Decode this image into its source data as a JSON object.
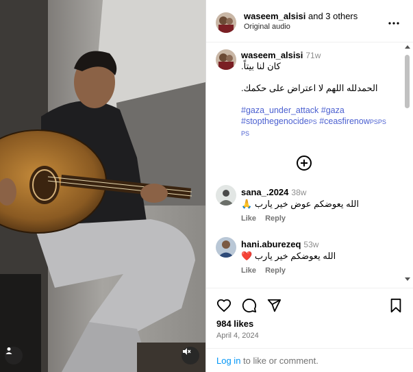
{
  "header": {
    "username": "waseem_alsisi",
    "others": "and 3 others",
    "subtitle": "Original audio",
    "more_icon": "more-horizontal-icon"
  },
  "caption": {
    "username": "waseem_alsisi",
    "time": "71w",
    "line1": "كان لنا بيتاً.",
    "line2": "الحمدلله اللهم لا اعتراض على حكمك.",
    "hashtags": [
      "#gaza_under_attack",
      "#gaza",
      "#stopthegenocide",
      "#ceasfirenow"
    ],
    "tag_suffix_1": "PS",
    "tag_suffix_2": "PSPS",
    "tag_suffix_3": "PS"
  },
  "comments": [
    {
      "username": "sana_.2024",
      "time": "38w",
      "text": "الله يعوضكم عوض خير يارب",
      "emoji": "🙏",
      "like_label": "Like",
      "reply_label": "Reply"
    },
    {
      "username": "hani.aburezeq",
      "time": "53w",
      "text": "الله يعوضكم خير يارب",
      "emoji": "❤️",
      "like_label": "Like",
      "reply_label": "Reply"
    }
  ],
  "actions": {
    "likes": "984 likes",
    "date": "April 4, 2024"
  },
  "footer": {
    "login": "Log in",
    "rest": " to like or comment."
  },
  "colors": {
    "link": "#0095f6",
    "hashtag": "#4a5fd0",
    "muted": "#737373",
    "border": "#dbdbdb"
  }
}
